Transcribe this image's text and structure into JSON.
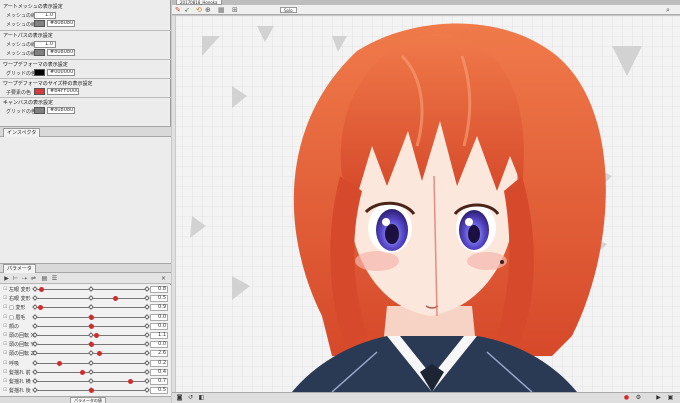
{
  "left_panel": {
    "art_mesh_section": {
      "title": "アートメッシュの表示設定",
      "line_width_label": "メッシュの線幅",
      "line_width_value": "1.0",
      "color_label": "メッシュの線色",
      "color_value": "#808080",
      "color_hex": "#808080"
    },
    "art_path_section": {
      "title": "アートパスの表示設定",
      "line_width_label": "メッシュの線幅",
      "line_width_value": "1.0",
      "color_label": "メッシュの線色",
      "color_value": "#808080",
      "color_hex": "#808080"
    },
    "warp_section": {
      "title": "ワープデフォーマの表示設定",
      "grid_label": "グリッドの色",
      "grid_value": "#000000",
      "grid_hex": "#000000"
    },
    "warp_size_section": {
      "title": "ワープデフォーマのサイズ枠の表示設定",
      "color_label": "子要素の色",
      "color_value": "#B4FF0000",
      "color_hex": "#d73b3b"
    },
    "canvas_section": {
      "title": "キャンバスの表示設定",
      "grid_label": "グリッドの色",
      "grid_value": "#808080",
      "grid_hex": "#808080"
    },
    "inspector_tab": "インスペクタ",
    "parameter_tab": "パラメータ",
    "bottom_label": "パラメータの値"
  },
  "parameters": [
    {
      "name": "左眼 変形",
      "value": "0.8",
      "marker": 0.06
    },
    {
      "name": "右眼 変形",
      "value": "0.5",
      "marker": 0.72
    },
    {
      "name": "□ 変形",
      "value": "0.9",
      "marker": 0.05
    },
    {
      "name": "□ 眉毛",
      "value": "0.0",
      "marker": 0.5
    },
    {
      "name": "顔の",
      "value": "0.0",
      "marker": 0.5
    },
    {
      "name": "頭の回転 X",
      "value": "1.1",
      "marker": 0.55
    },
    {
      "name": "頭の回転 Y",
      "value": "0.0",
      "marker": 0.5
    },
    {
      "name": "頭の回転 Z",
      "value": "2.6",
      "marker": 0.58
    },
    {
      "name": "呼吸",
      "value": "0.2",
      "marker": 0.22
    },
    {
      "name": "髪揺れ 前",
      "value": "0.4",
      "marker": 0.42
    },
    {
      "name": "髪揺れ 横",
      "value": "0.7",
      "marker": 0.85
    },
    {
      "name": "髪揺れ 後",
      "value": "0.5",
      "marker": 0.5
    }
  ],
  "editor": {
    "tab_title": "20170818_Honoka",
    "solo_label": "Solo"
  },
  "colors": {
    "hair": "#e35a2c",
    "hair_dark": "#b53a1c",
    "skin": "#fbe7dc",
    "eye": "#5b4bd0",
    "uniform": "#2b3a54",
    "accent_red": "#d42a2a"
  }
}
